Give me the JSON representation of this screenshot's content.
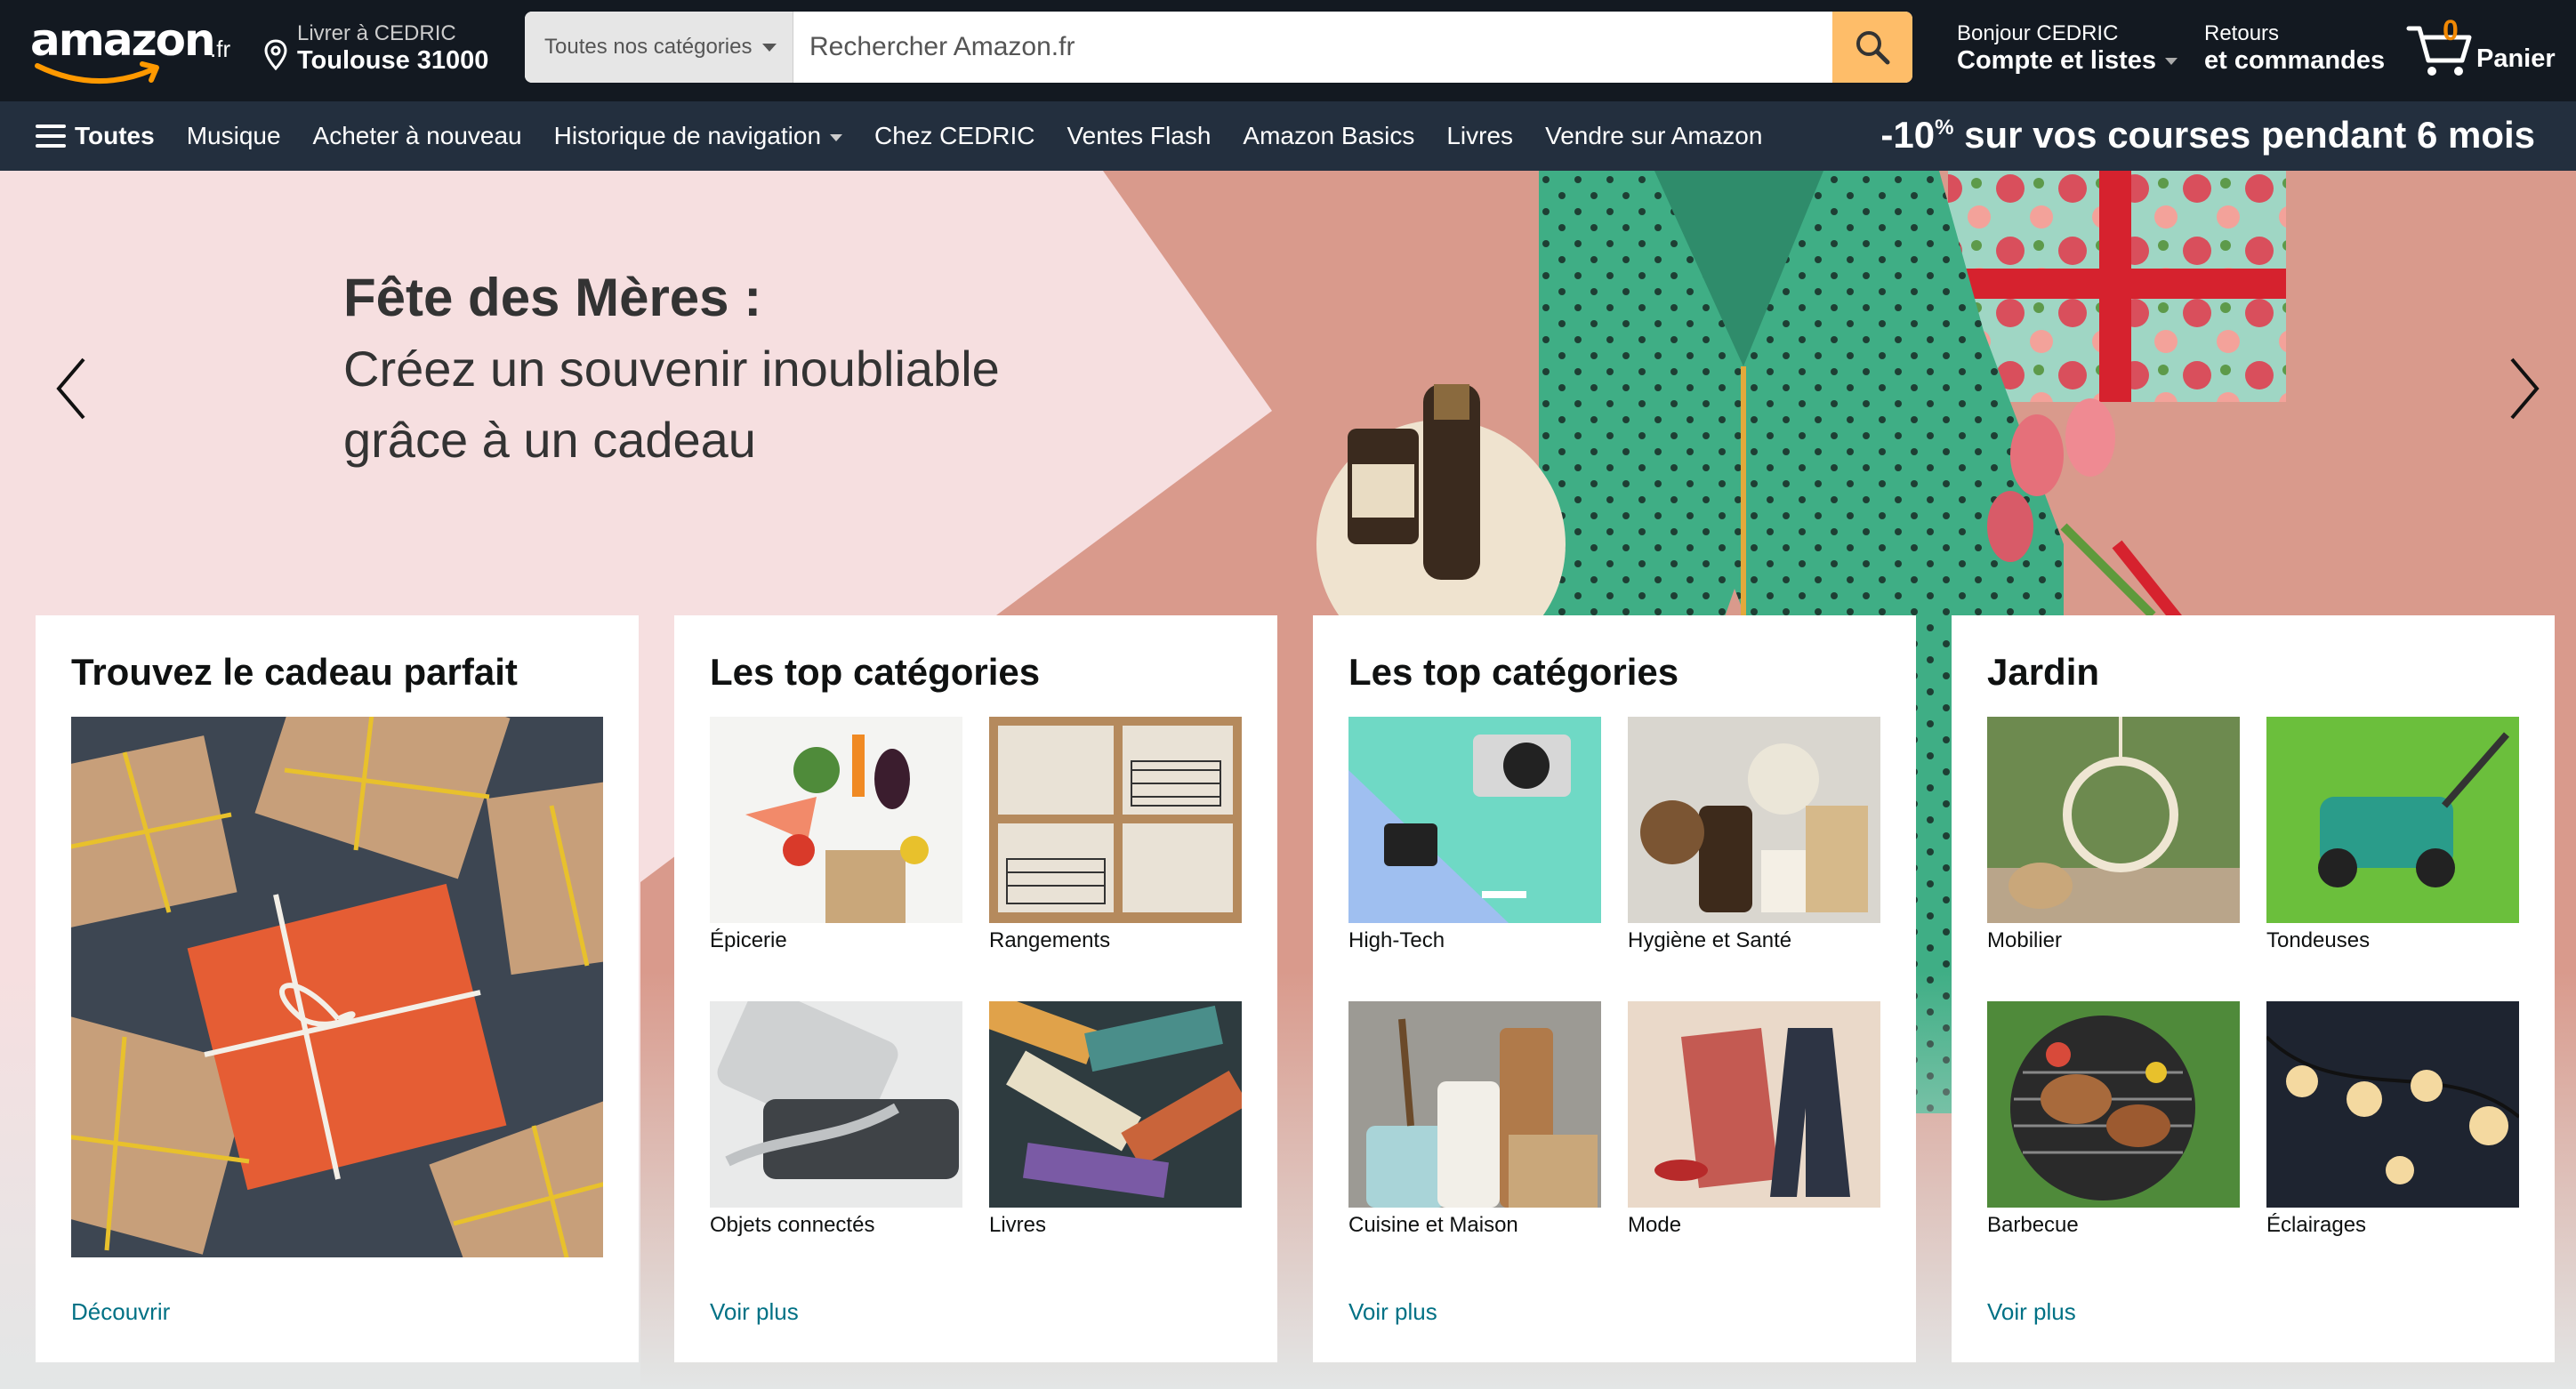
{
  "header": {
    "logo_text": "amazon",
    "logo_tld": ".fr",
    "deliver_line1": "Livrer à CEDRIC",
    "deliver_line2": "Toulouse 31000",
    "search_category": "Toutes nos catégories",
    "search_placeholder": "Rechercher Amazon.fr",
    "account_line1": "Bonjour CEDRIC",
    "account_line2": "Compte et listes",
    "returns_line1": "Retours",
    "returns_line2": "et commandes",
    "cart_count": "0",
    "cart_label": "Panier",
    "icons": [
      "location-pin-icon",
      "search-icon",
      "cart-icon",
      "menu-icon",
      "chevron-down-icon"
    ],
    "accent_color": "#febd69"
  },
  "subnav": {
    "all_label": "Toutes",
    "items": [
      "Musique",
      "Acheter à nouveau",
      "Historique de navigation",
      "Chez CEDRIC",
      "Ventes Flash",
      "Amazon Basics",
      "Livres",
      "Vendre sur Amazon"
    ],
    "promo_prefix": "-10",
    "promo_sup": "%",
    "promo_suffix": " sur vos courses pendant 6 mois"
  },
  "hero": {
    "title": "Fête des Mères :",
    "subtitle_line1": "Créez un souvenir inoubliable",
    "subtitle_line2": "grâce à un cadeau"
  },
  "cards": [
    {
      "title": "Trouvez le cadeau parfait",
      "link": "Découvrir"
    },
    {
      "title": "Les top catégories",
      "tiles": [
        "Épicerie",
        "Rangements",
        "Objets connectés",
        "Livres"
      ],
      "link": "Voir plus"
    },
    {
      "title": "Les top catégories",
      "tiles": [
        "High-Tech",
        "Hygiène et Santé",
        "Cuisine et Maison",
        "Mode"
      ],
      "link": "Voir plus"
    },
    {
      "title": "Jardin",
      "tiles": [
        "Mobilier",
        "Tondeuses",
        "Barbecue",
        "Éclairages"
      ],
      "link": "Voir plus"
    }
  ]
}
